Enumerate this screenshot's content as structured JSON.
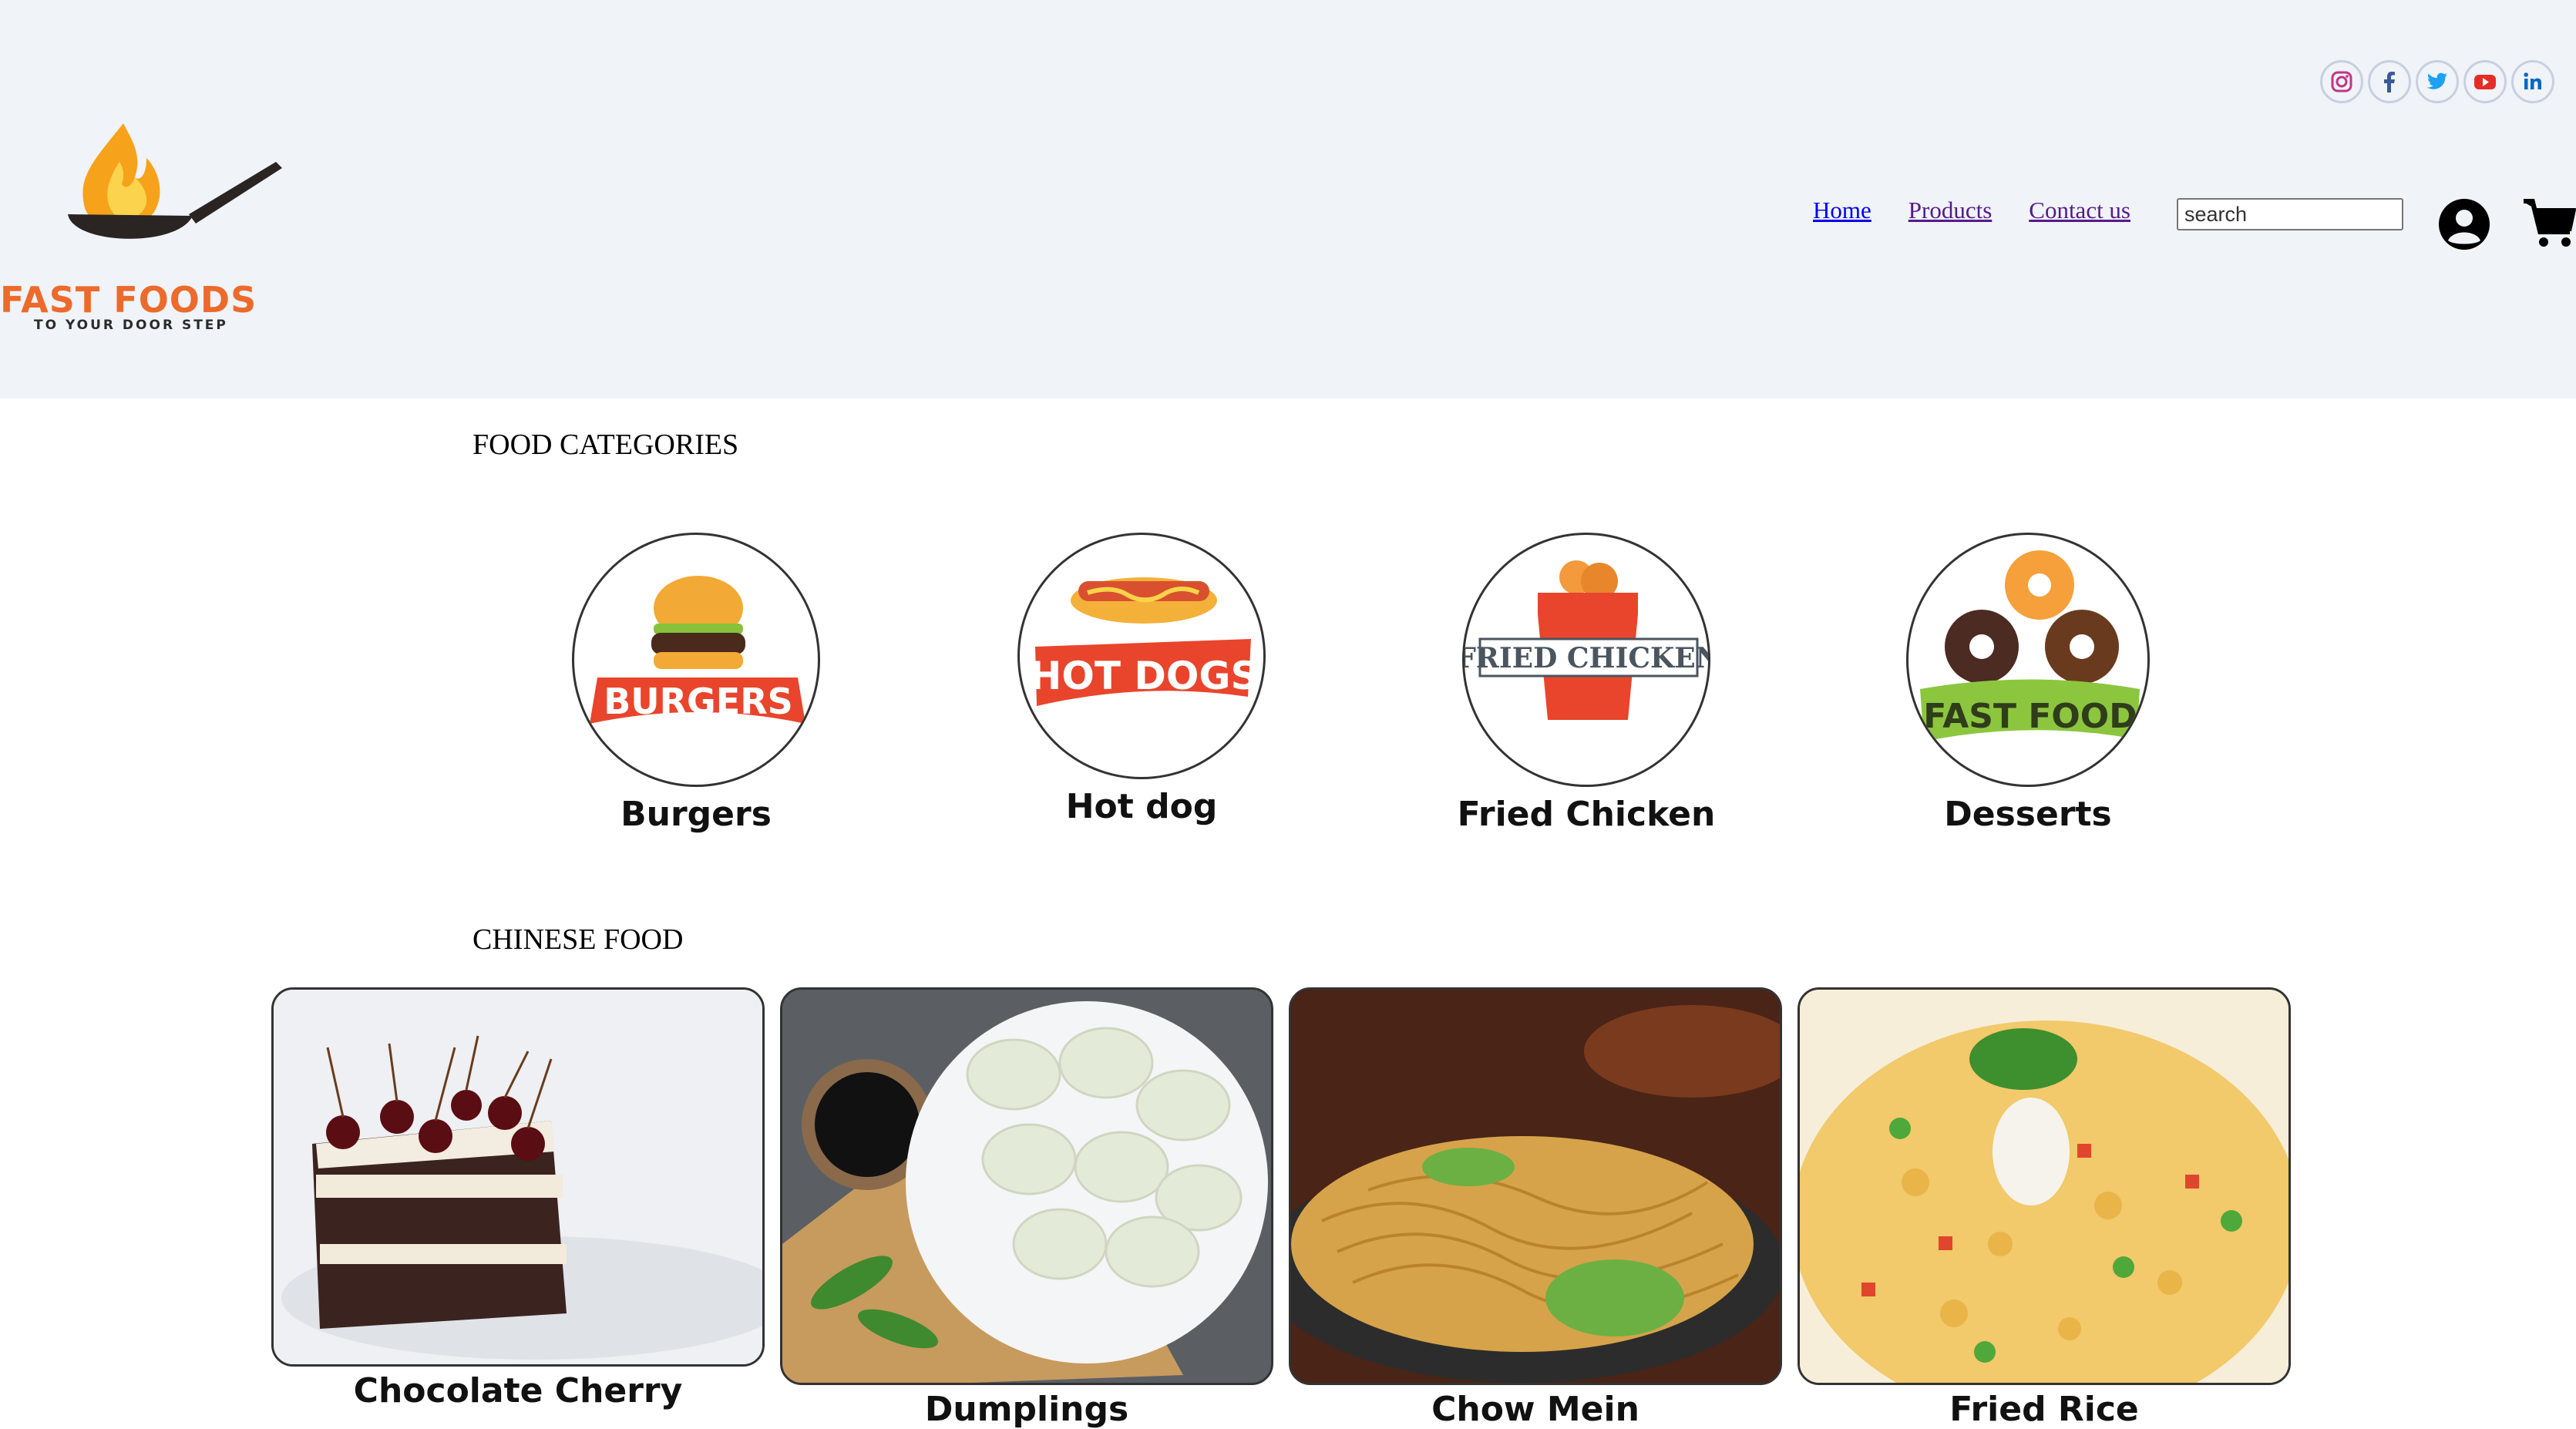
{
  "brand": {
    "name": "FAST FOODS",
    "tagline": "TO YOUR DOOR STEP",
    "color": "#ec6a2c"
  },
  "social": [
    {
      "icon": "instagram-icon",
      "color": "#c13584"
    },
    {
      "icon": "facebook-icon",
      "color": "#3b5998"
    },
    {
      "icon": "twitter-icon",
      "color": "#1da1f2"
    },
    {
      "icon": "youtube-icon",
      "color": "#e52d27"
    },
    {
      "icon": "linkedin-icon",
      "color": "#0a66c2"
    }
  ],
  "nav": {
    "home": "Home",
    "products": "Products",
    "contact": "Contact us"
  },
  "search": {
    "placeholder": "search"
  },
  "sections": {
    "categories_title": "FOOD CATEGORIES",
    "chinese_title": "CHINESE FOOD"
  },
  "categories": [
    {
      "label": "Burgers",
      "badge": "BURGERS"
    },
    {
      "label": "Hot dog",
      "badge": "HOT DOGS"
    },
    {
      "label": "Fried Chicken",
      "badge": "FRIED CHICKEN"
    },
    {
      "label": "Desserts",
      "badge": "FAST FOOD"
    }
  ],
  "chinese_food": [
    {
      "label": "Chocolate Cherry"
    },
    {
      "label": "Dumplings"
    },
    {
      "label": "Chow Mein"
    },
    {
      "label": "Fried Rice"
    }
  ]
}
